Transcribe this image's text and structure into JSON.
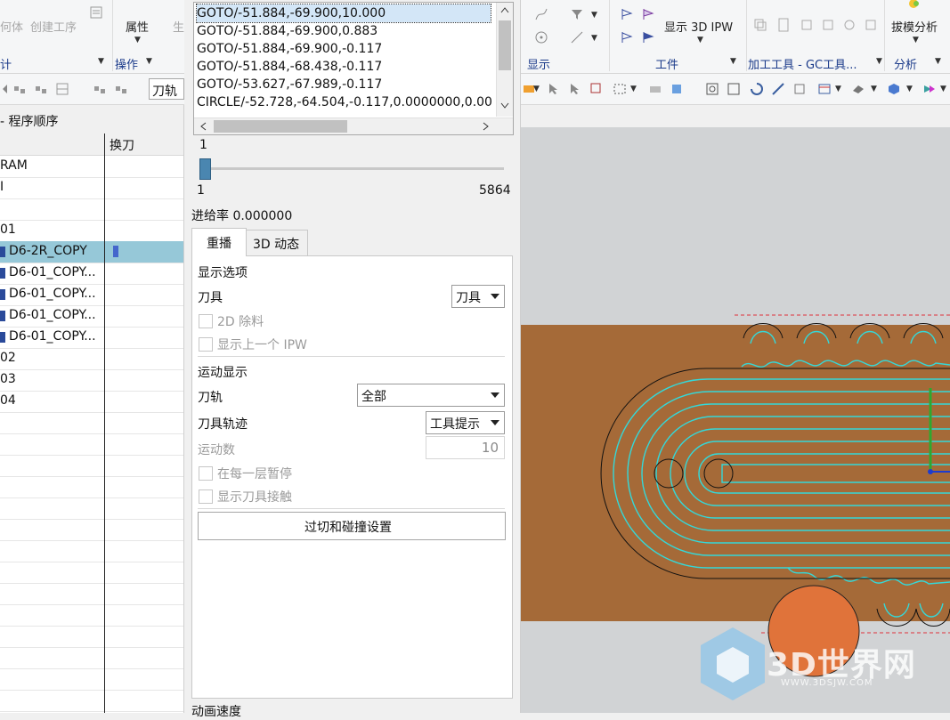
{
  "ribbon": {
    "geometry_label": "何体",
    "create_operation": "创建工序",
    "properties": "属性",
    "generate_partial": "生",
    "left_group_partial": "计",
    "operations_group": "操作",
    "display_group": "显示",
    "show_3d_ipw": "显示 3D IPW",
    "workpiece_group": "工件",
    "machining_tools_group": "加工工具 - GC工具...",
    "draft_analysis": "拔模分析",
    "analysis_group": "分析"
  },
  "toolbar": {
    "filter_value": "刀轨"
  },
  "navigator": {
    "title": "- 程序顺序",
    "col_toolchange": "换刀",
    "rows": [
      "RAM",
      "I",
      "",
      "01",
      "D6-2R_COPY",
      "D6-01_COPY...",
      "D6-01_COPY...",
      "D6-01_COPY...",
      "D6-01_COPY...",
      "02",
      "03",
      "04"
    ]
  },
  "dialog": {
    "path_list": [
      "GOTO/-51.884,-69.900,10.000",
      "GOTO/-51.884,-69.900,0.883",
      "GOTO/-51.884,-69.900,-0.117",
      "GOTO/-51.884,-68.438,-0.117",
      "GOTO/-53.627,-67.989,-0.117",
      "CIRCLE/-52.728,-64.504,-0.117,0.0000000,0.00"
    ],
    "slider_current": "1",
    "slider_min": "1",
    "slider_max": "5864",
    "slider_fraction": 0.0,
    "feed_rate": "进给率 0.000000",
    "tab_replay": "重播",
    "tab_3d": "3D 动态",
    "display_options": "显示选项",
    "tool_label": "刀具",
    "tool_value": "刀具",
    "remove_2d": "2D 除料",
    "show_prev_ipw": "显示上一个 IPW",
    "motion_display": "运动显示",
    "toolpath_label": "刀轨",
    "toolpath_value": "全部",
    "tool_trace_label": "刀具轨迹",
    "tool_trace_value": "工具提示",
    "motion_count_label": "运动数",
    "motion_count_value": "10",
    "pause_each_layer": "在每一层暂停",
    "show_tool_contact": "显示刀具接触",
    "gouge_button": "过切和碰撞设置",
    "animation_speed": "动画速度"
  },
  "graphics": {
    "watermark_title": "3D世界网",
    "watermark_url": "WWW.3DSJW.COM",
    "colors": {
      "stock": "#a56a38",
      "toolpath": "#34d8d8",
      "tool": "#e0733a",
      "background": "#d1d3d5"
    }
  }
}
